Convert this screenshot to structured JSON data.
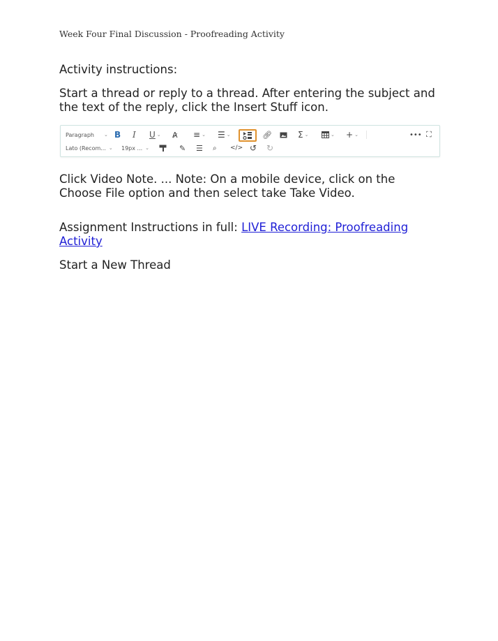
{
  "header": {
    "doc_title": "Week Four Final Discussion - Proofreading Activity"
  },
  "content": {
    "activity_heading": "Activity instructions:",
    "paragraph_1": "Start a thread or reply to a thread. After entering the subject and the text of the reply, click the Insert Stuff icon.",
    "paragraph_2": "Click Video Note. ... Note: On a mobile device, click on the Choose File option and then select take Take Video.",
    "assignment_prefix": "Assignment Instructions in full: ",
    "assignment_link": "LIVE Recording: Proofreading Activity",
    "new_thread": "Start a New Thread"
  },
  "toolbar": {
    "paragraph_select": "Paragraph",
    "font_select": "Lato (Recom...",
    "size_select": "19px ...",
    "icons": [
      "bold-icon",
      "italic-icon",
      "underline-icon",
      "strikethrough-icon",
      "align-icon",
      "list-icon",
      "insert-stuff-icon",
      "link-icon",
      "image-icon",
      "equation-icon",
      "table-icon",
      "add-icon",
      "more-icon",
      "fullscreen-icon",
      "format-painter-icon",
      "highlight-icon",
      "horizontal-rule-icon",
      "find-icon",
      "source-code-icon",
      "undo-icon",
      "redo-icon"
    ],
    "highlight_color": "#e0922e",
    "bold_color": "#2b6cb0"
  }
}
